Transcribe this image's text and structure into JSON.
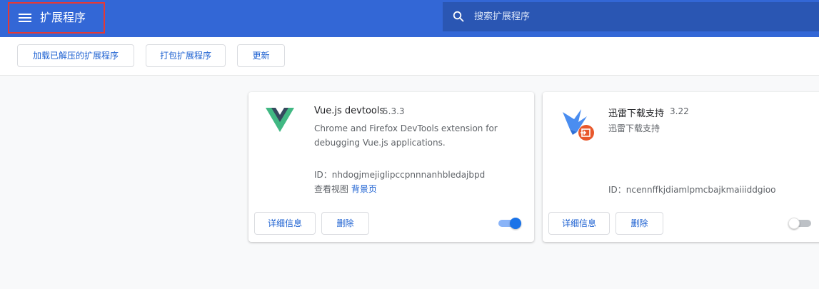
{
  "header": {
    "title": "扩展程序",
    "search_placeholder": "搜索扩展程序"
  },
  "toolbar": {
    "load_unpacked": "加载已解压的扩展程序",
    "pack": "打包扩展程序",
    "update": "更新"
  },
  "extensions": [
    {
      "name": "Vue.js devtools",
      "version": "5.3.3",
      "description_line1": "Chrome and Firefox DevTools extension for",
      "description_line2": "debugging Vue.js applications.",
      "id": "ID：nhdogjmejiglipccpnnnanhbledajbpd",
      "inspect_label": "查看视图",
      "background_link": "背景页",
      "details_label": "详细信息",
      "remove_label": "删除",
      "enabled": true,
      "icon": "vue-logo-icon"
    },
    {
      "name": "迅雷下载支持",
      "version": "3.22",
      "description_line1": "迅雷下载支持",
      "id": "ID：ncennffkjdiamlpmcbajkmaiiiddgioo",
      "details_label": "详细信息",
      "remove_label": "删除",
      "enabled": false,
      "icon": "thunder-logo-icon"
    }
  ],
  "colors": {
    "header_bg": "#3367d6",
    "search_bg": "#2a56b3",
    "accent": "#1a73e8",
    "highlight_border": "#e53935"
  }
}
